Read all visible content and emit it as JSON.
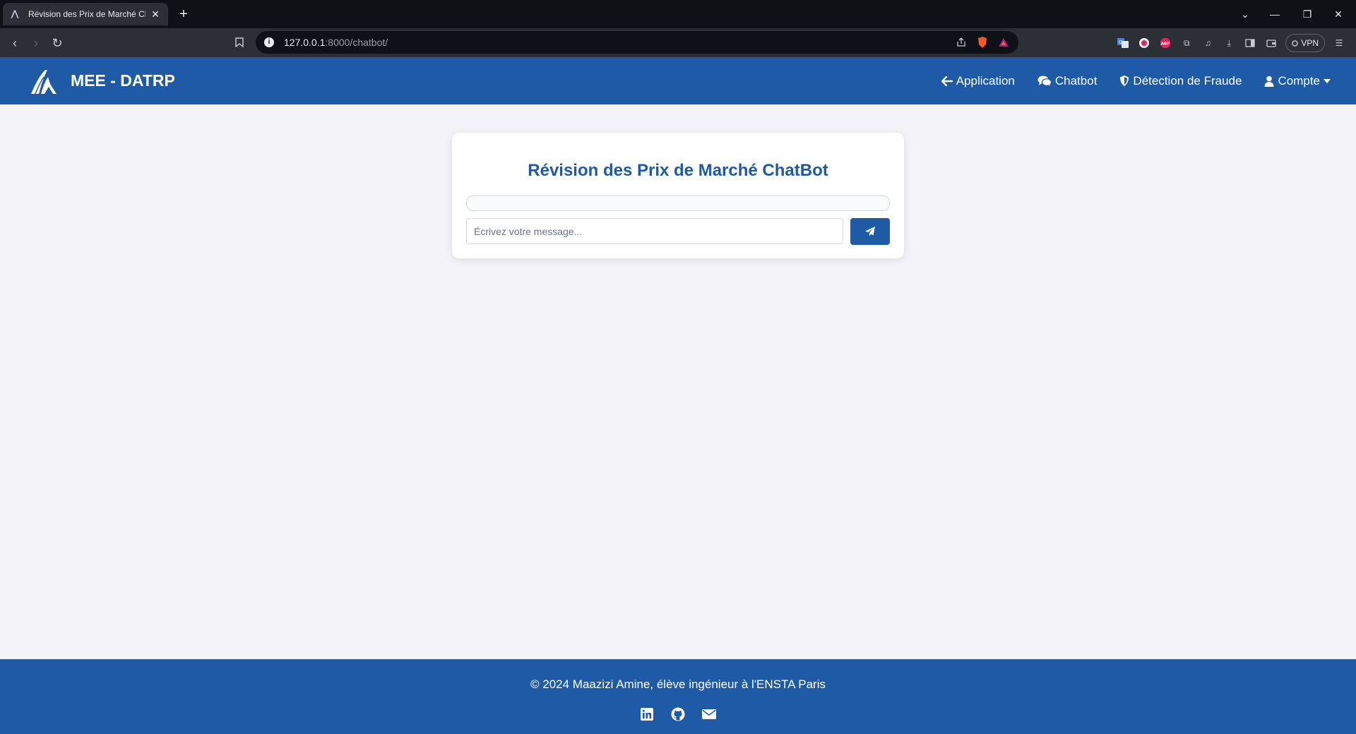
{
  "browser": {
    "tab_title": "Révision des Prix de Marché Ch",
    "url_host": "127.0.0.1",
    "url_rest": ":8000/chatbot/",
    "vpn_label": "VPN",
    "abp_label": "ABP"
  },
  "navbar": {
    "brand": "MEE - DATRP",
    "links": [
      {
        "label": "Application",
        "icon": "arrow-left-icon"
      },
      {
        "label": "Chatbot",
        "icon": "comments-icon"
      },
      {
        "label": "Détection de Fraude",
        "icon": "shield-icon"
      },
      {
        "label": "Compte",
        "icon": "user-icon"
      }
    ]
  },
  "chat": {
    "title": "Révision des Prix de Marché ChatBot",
    "input_placeholder": "Écrivez votre message...",
    "send_icon": "paper-plane-icon"
  },
  "footer": {
    "text": "© 2024 Maazizi Amine, élève ingénieur à l'ENSTA Paris",
    "icons": [
      "linkedin-icon",
      "github-icon",
      "envelope-icon"
    ]
  },
  "colors": {
    "primary": "#1f5aa6",
    "page_bg": "#f4f4f8",
    "browser_dark": "#0e1116",
    "browser_toolbar": "#2b2f36"
  }
}
